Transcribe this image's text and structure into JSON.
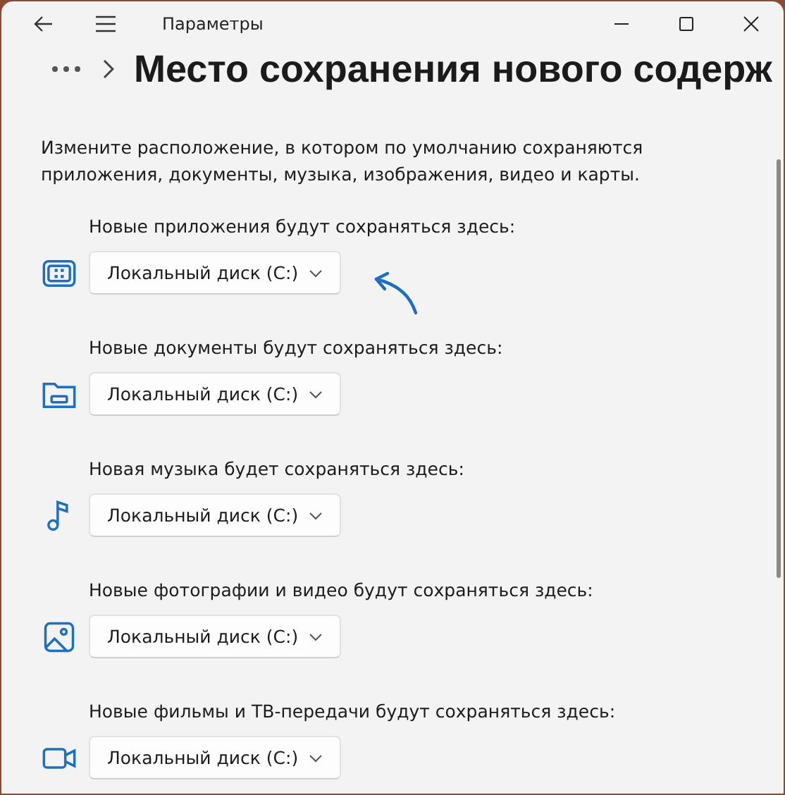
{
  "window": {
    "title": "Параметры"
  },
  "page": {
    "heading": "Место сохранения нового содерж",
    "description": "Измените расположение, в котором по умолчанию сохраняются приложения, документы, музыка, изображения, видео и карты."
  },
  "locations": [
    {
      "kind": "apps",
      "label": "Новые приложения будут сохраняться здесь:",
      "value": "Локальный диск (C:)",
      "annotated": true
    },
    {
      "kind": "documents",
      "label": "Новые документы будут сохраняться здесь:",
      "value": "Локальный диск (C:)",
      "annotated": false
    },
    {
      "kind": "music",
      "label": "Новая музыка будет сохраняться здесь:",
      "value": "Локальный диск (C:)",
      "annotated": false
    },
    {
      "kind": "photos",
      "label": "Новые фотографии и видео будут сохраняться здесь:",
      "value": "Локальный диск (C:)",
      "annotated": false
    },
    {
      "kind": "movies",
      "label": "Новые фильмы и ТВ-передачи будут сохраняться здесь:",
      "value": "Локальный диск (C:)",
      "annotated": false
    }
  ]
}
